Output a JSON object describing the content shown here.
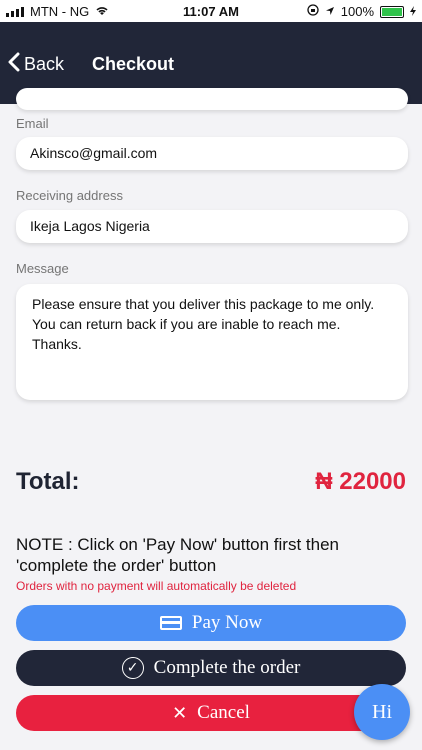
{
  "status_bar": {
    "carrier": "MTN - NG",
    "time": "11:07 AM",
    "battery_percent": "100%"
  },
  "nav": {
    "back_label": "Back",
    "title": "Checkout"
  },
  "form": {
    "email_label": "Email",
    "email_value": "Akinsco@gmail.com",
    "address_label": "Receiving address",
    "address_value": "Ikeja Lagos Nigeria",
    "message_label": "Message",
    "message_value": "Please ensure that you deliver this package to me only. You can return back if you are inable to reach me. Thanks."
  },
  "total": {
    "label": "Total:",
    "value": "₦ 22000"
  },
  "note": "NOTE : Click on 'Pay Now' button first then 'complete the order' button",
  "warning": "Orders with no payment will automatically be deleted",
  "buttons": {
    "pay_now": "Pay Now",
    "complete": "Complete the order",
    "cancel": "Cancel"
  },
  "chat": {
    "label": "Hi"
  },
  "colors": {
    "nav_bg": "#212638",
    "pay_blue": "#4b8ff5",
    "accent_red": "#e0243f"
  }
}
